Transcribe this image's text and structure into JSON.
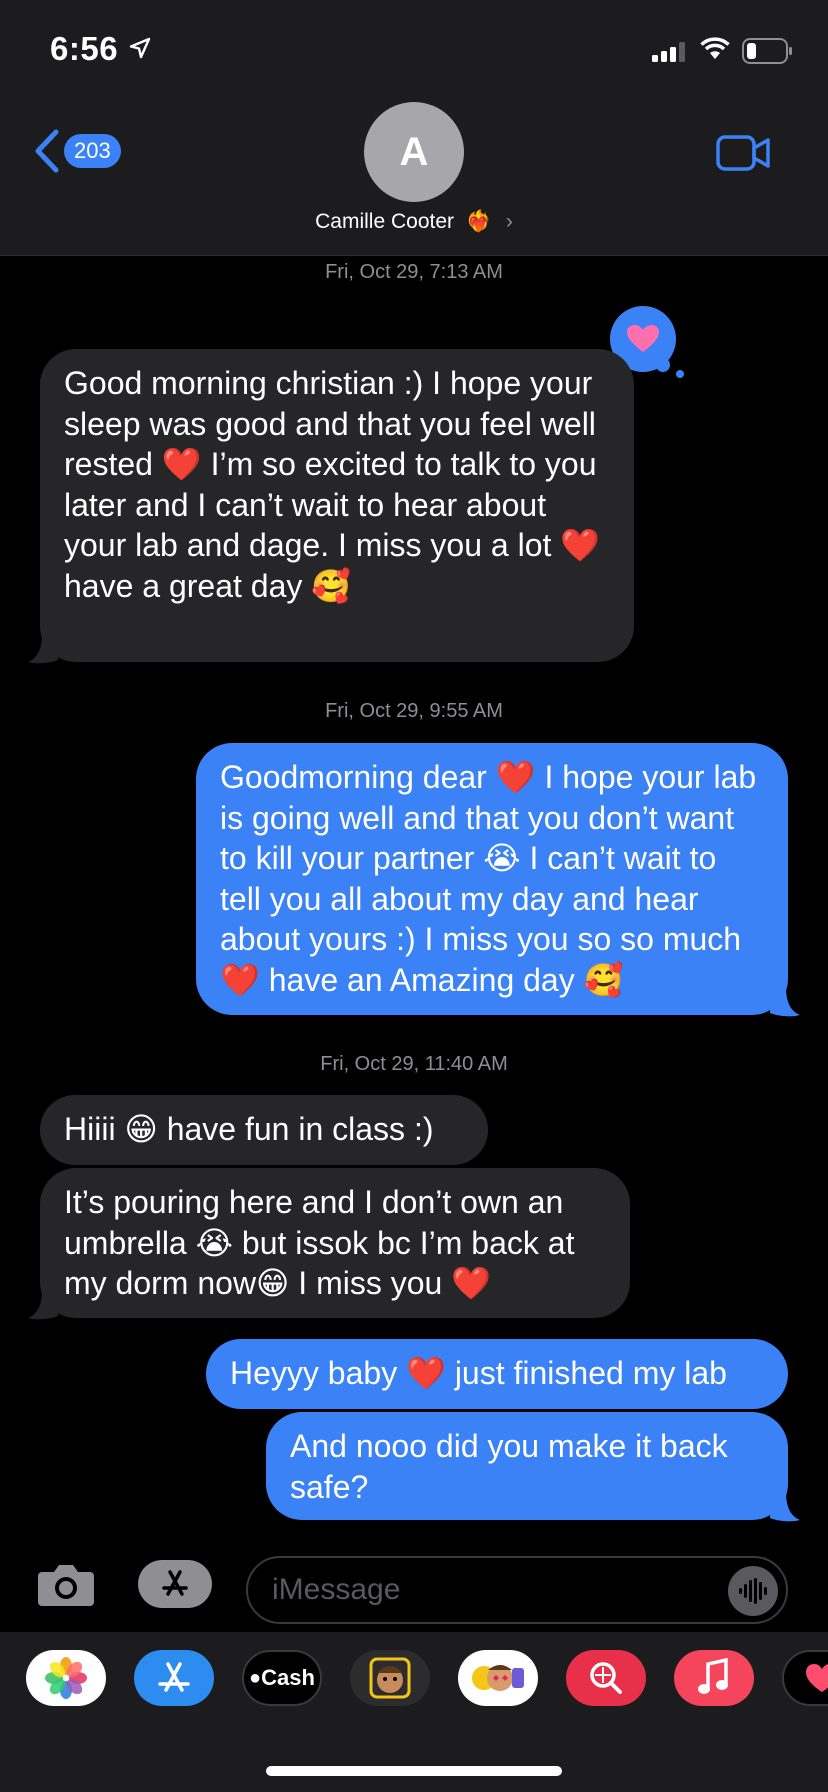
{
  "status_bar": {
    "time": "6:56"
  },
  "header": {
    "back_count": "203",
    "avatar_initial": "A",
    "contact_name": "Camille Cooter",
    "contact_emoji": "❤️‍🔥"
  },
  "conversation": {
    "timestamps": [
      "Fri, Oct 29, 7:13 AM",
      "Fri, Oct 29, 9:55 AM",
      "Fri, Oct 29, 11:40 AM"
    ],
    "messages": [
      {
        "direction": "incoming",
        "text": "Good morning christian :) I hope your sleep was good and that you feel well rested ❤️ I’m so excited to talk to you later and I can’t wait to hear about your lab and dage. I miss you a lot ❤️ have a great day 🥰",
        "reaction": "heart"
      },
      {
        "direction": "outgoing",
        "text": "Goodmorning dear ❤️ I hope your lab is going well and that you don’t want to kill your partner 😭 I can’t wait to tell you all about my day and hear about yours :) I miss you so so much ❤️ have an Amazing day 🥰"
      },
      {
        "direction": "incoming",
        "text": "Hiiii 😁 have fun in class :)"
      },
      {
        "direction": "incoming",
        "text": "It’s pouring here and I don’t own an umbrella 😭 but issok bc I’m back at my dorm now😁 I miss you ❤️"
      },
      {
        "direction": "outgoing",
        "text": "Heyyy baby ❤️ just finished my lab"
      },
      {
        "direction": "outgoing",
        "text": "And nooo did you make it back safe?"
      }
    ]
  },
  "input": {
    "placeholder": "iMessage"
  },
  "app_drawer": {
    "apps": [
      "photos-icon",
      "app-store-icon",
      "apple-cash-icon",
      "memoji-icon",
      "memoji-stickers-icon",
      "images-search-icon",
      "music-icon",
      "digital-touch-icon"
    ],
    "cash_label": "Cash"
  },
  "colors": {
    "outgoing_bubble": "#3b82f6",
    "incoming_bubble": "#262628",
    "header_bg": "#1c1c1e"
  }
}
